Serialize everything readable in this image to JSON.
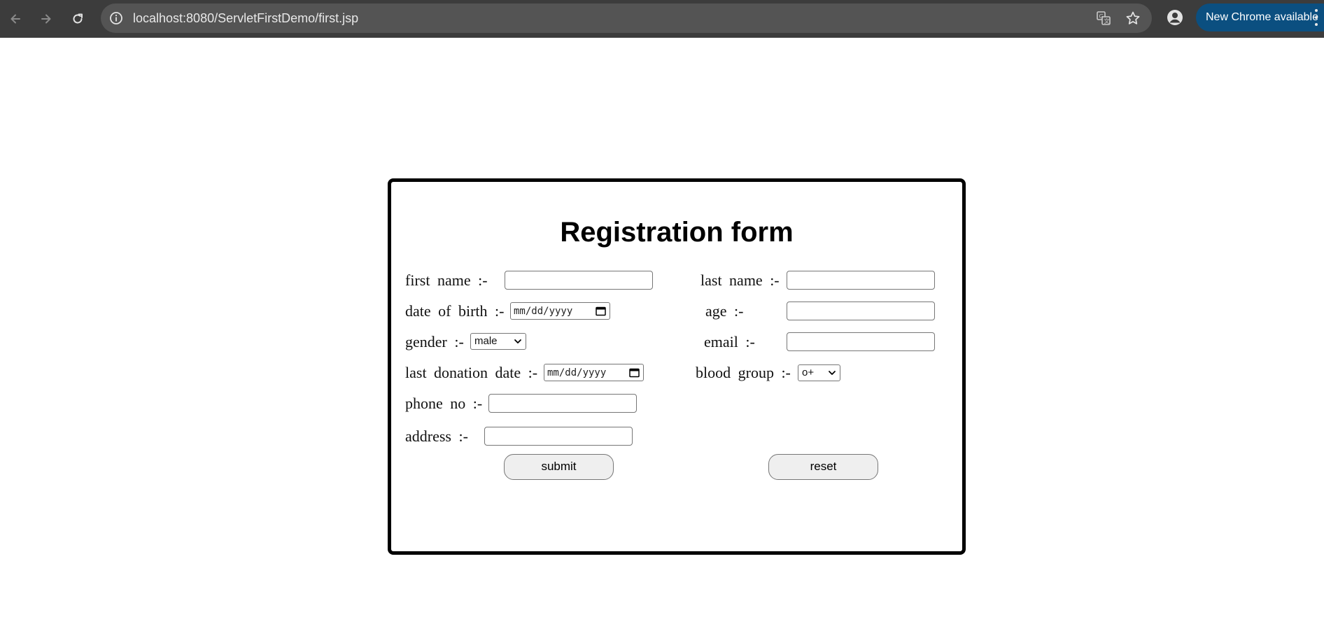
{
  "browser": {
    "url": "localhost:8080/ServletFirstDemo/first.jsp",
    "update_label": "New Chrome available"
  },
  "form": {
    "title": "Registration form",
    "labels": {
      "first_name": "first name :-",
      "last_name": "last name :-",
      "date_of_birth": "date of birth :-",
      "age": "age :-",
      "gender": "gender :-",
      "email": "email :-",
      "last_donation_date": "last donation date :-",
      "blood_group": "blood group :-",
      "phone_no": "phone no :-",
      "address": "address :-"
    },
    "values": {
      "first_name": "",
      "last_name": "",
      "age": "",
      "email": "",
      "phone_no": "",
      "address": ""
    },
    "date_placeholder": "mm/dd/yyyy",
    "gender_selected": "male",
    "blood_group_selected": "o+",
    "buttons": {
      "submit": "submit",
      "reset": "reset"
    }
  }
}
